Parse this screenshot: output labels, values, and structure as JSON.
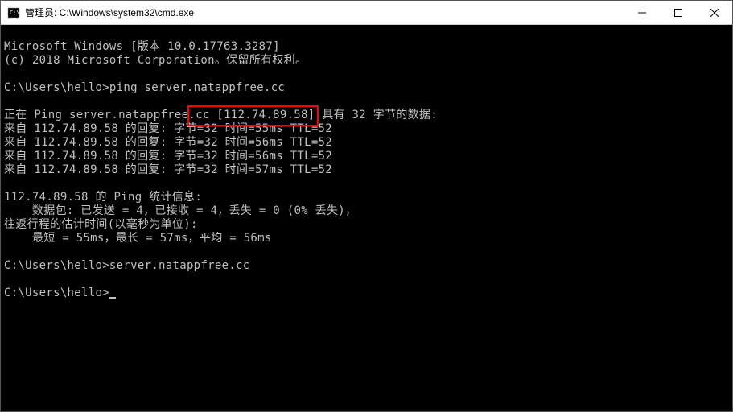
{
  "window": {
    "title": "管理员: C:\\Windows\\system32\\cmd.exe"
  },
  "terminal": {
    "version_line": "Microsoft Windows [版本 10.0.17763.3287]",
    "copyright_line": "(c) 2018 Microsoft Corporation。保留所有权利。",
    "blank": "",
    "prompt1": "C:\\Users\\hello>ping server.natappfree.cc",
    "ping_header": "正在 Ping server.natappfree.cc [112.74.89.58] 具有 32 字节的数据:",
    "reply1": "来自 112.74.89.58 的回复: 字节=32 时间=55ms TTL=52",
    "reply2": "来自 112.74.89.58 的回复: 字节=32 时间=56ms TTL=52",
    "reply3": "来自 112.74.89.58 的回复: 字节=32 时间=56ms TTL=52",
    "reply4": "来自 112.74.89.58 的回复: 字节=32 时间=57ms TTL=52",
    "stats_header": "112.74.89.58 的 Ping 统计信息:",
    "packets_line": "    数据包: 已发送 = 4，已接收 = 4，丢失 = 0 (0% 丢失)，",
    "rtt_header": "往返行程的估计时间(以毫秒为单位):",
    "rtt_line": "    最短 = 55ms，最长 = 57ms，平均 = 56ms",
    "prompt2": "C:\\Users\\hello>server.natappfree.cc",
    "prompt3": "C:\\Users\\hello>"
  }
}
